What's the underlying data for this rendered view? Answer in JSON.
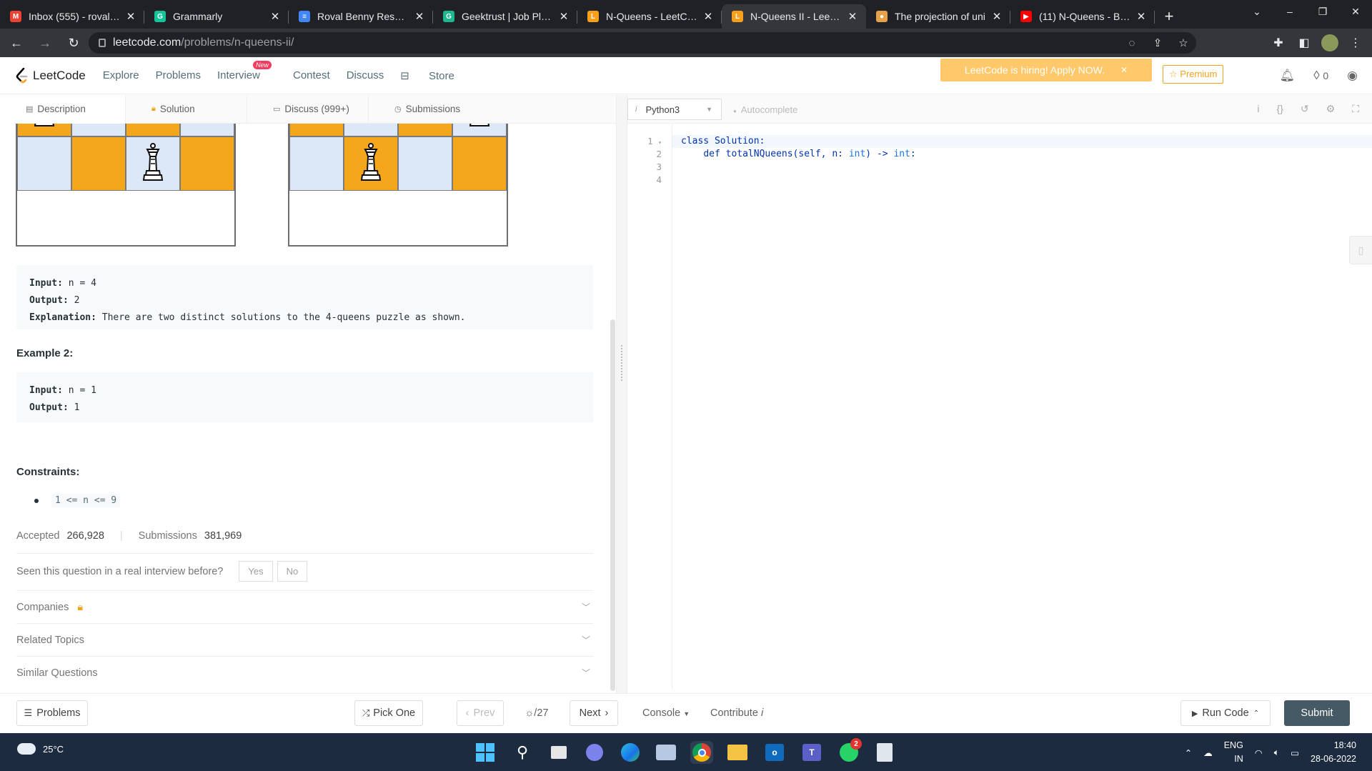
{
  "browser": {
    "tabs": [
      {
        "title": "Inbox (555) - rovalbe",
        "favicon": "gmail-icon",
        "color": "#ea4335",
        "letter": "M"
      },
      {
        "title": "Grammarly",
        "favicon": "grammarly-icon",
        "color": "#15c39a",
        "letter": "G"
      },
      {
        "title": "Roval Benny Resume",
        "favicon": "docs-icon",
        "color": "#4285f4",
        "letter": "≡"
      },
      {
        "title": "Geektrust | Job Platfo",
        "favicon": "geektrust-icon",
        "color": "#1fb58f",
        "letter": "G"
      },
      {
        "title": "N-Queens - LeetCod",
        "favicon": "leetcode-icon",
        "color": "#f89f1b",
        "letter": "L"
      },
      {
        "title": "N-Queens II - LeetCo",
        "favicon": "leetcode-icon",
        "color": "#f89f1b",
        "letter": "L",
        "active": true
      },
      {
        "title": "The projection of uni",
        "favicon": "site-icon",
        "color": "#e6a24a",
        "letter": "●"
      },
      {
        "title": "(11) N-Queens - Bac",
        "favicon": "youtube-icon",
        "color": "#ff0000",
        "letter": "▶"
      }
    ],
    "url_host": "leetcode.com",
    "url_path": "/problems/n-queens-ii/"
  },
  "header": {
    "logo_text": "LeetCode",
    "nav": [
      "Explore",
      "Problems",
      "Interview",
      "Contest",
      "Discuss"
    ],
    "new_badge": "New",
    "store": "Store",
    "hiring_banner": "LeetCode is hiring! Apply NOW.",
    "premium": "Premium",
    "streak_count": "0"
  },
  "subtabs": [
    "Description",
    "Solution",
    "Discuss (999+)",
    "Submissions"
  ],
  "example1": {
    "input_label": "Input:",
    "input_value": "n = 4",
    "output_label": "Output:",
    "output_value": "2",
    "explanation_label": "Explanation:",
    "explanation_value": "There are two distinct solutions to the 4-queens puzzle as shown."
  },
  "example2": {
    "heading": "Example 2:",
    "input_label": "Input:",
    "input_value": "n = 1",
    "output_label": "Output:",
    "output_value": "1"
  },
  "constraints": {
    "heading": "Constraints:",
    "items": [
      "1 <= n <= 9"
    ]
  },
  "stats": {
    "accepted_label": "Accepted",
    "accepted_value": "266,928",
    "submissions_label": "Submissions",
    "submissions_value": "381,969"
  },
  "interview_question": {
    "text": "Seen this question in a real interview before?",
    "yes": "Yes",
    "no": "No"
  },
  "accordions": [
    "Companies",
    "Related Topics",
    "Similar Questions"
  ],
  "editor": {
    "language": "Python3",
    "autocomplete": "Autocomplete",
    "line_numbers": [
      "1",
      "2",
      "3",
      "4"
    ],
    "code_line1_kw": "class",
    "code_line1_rest": " Solution:",
    "code_line2_kw": "def",
    "code_line2_rest": " totalNQueens(self, n: ",
    "code_line2_type1": "int",
    "code_line2_arrow": ") -> ",
    "code_line2_type2": "int",
    "code_line2_end": ":"
  },
  "bottom_bar": {
    "problems": "Problems",
    "pick_one": "Pick One",
    "prev": "Prev",
    "page": "/27",
    "next": "Next",
    "console": "Console",
    "contribute": "Contribute",
    "run_code": "Run Code",
    "submit": "Submit"
  },
  "taskbar": {
    "temperature": "25°C",
    "lang1": "ENG",
    "lang2": "IN",
    "time": "18:40",
    "date": "28-06-2022",
    "whatsapp_badge": "2"
  },
  "boards": [
    {
      "cells": [
        "l",
        "d",
        "l",
        "d",
        "d",
        "l",
        "d",
        "l",
        "l",
        "d",
        "l",
        "d"
      ],
      "queens": [
        3,
        4,
        10
      ]
    },
    {
      "cells": [
        "l",
        "d",
        "l",
        "d",
        "d",
        "l",
        "d",
        "l",
        "l",
        "d",
        "l",
        "d"
      ],
      "queens": [
        0,
        7,
        9
      ]
    }
  ]
}
